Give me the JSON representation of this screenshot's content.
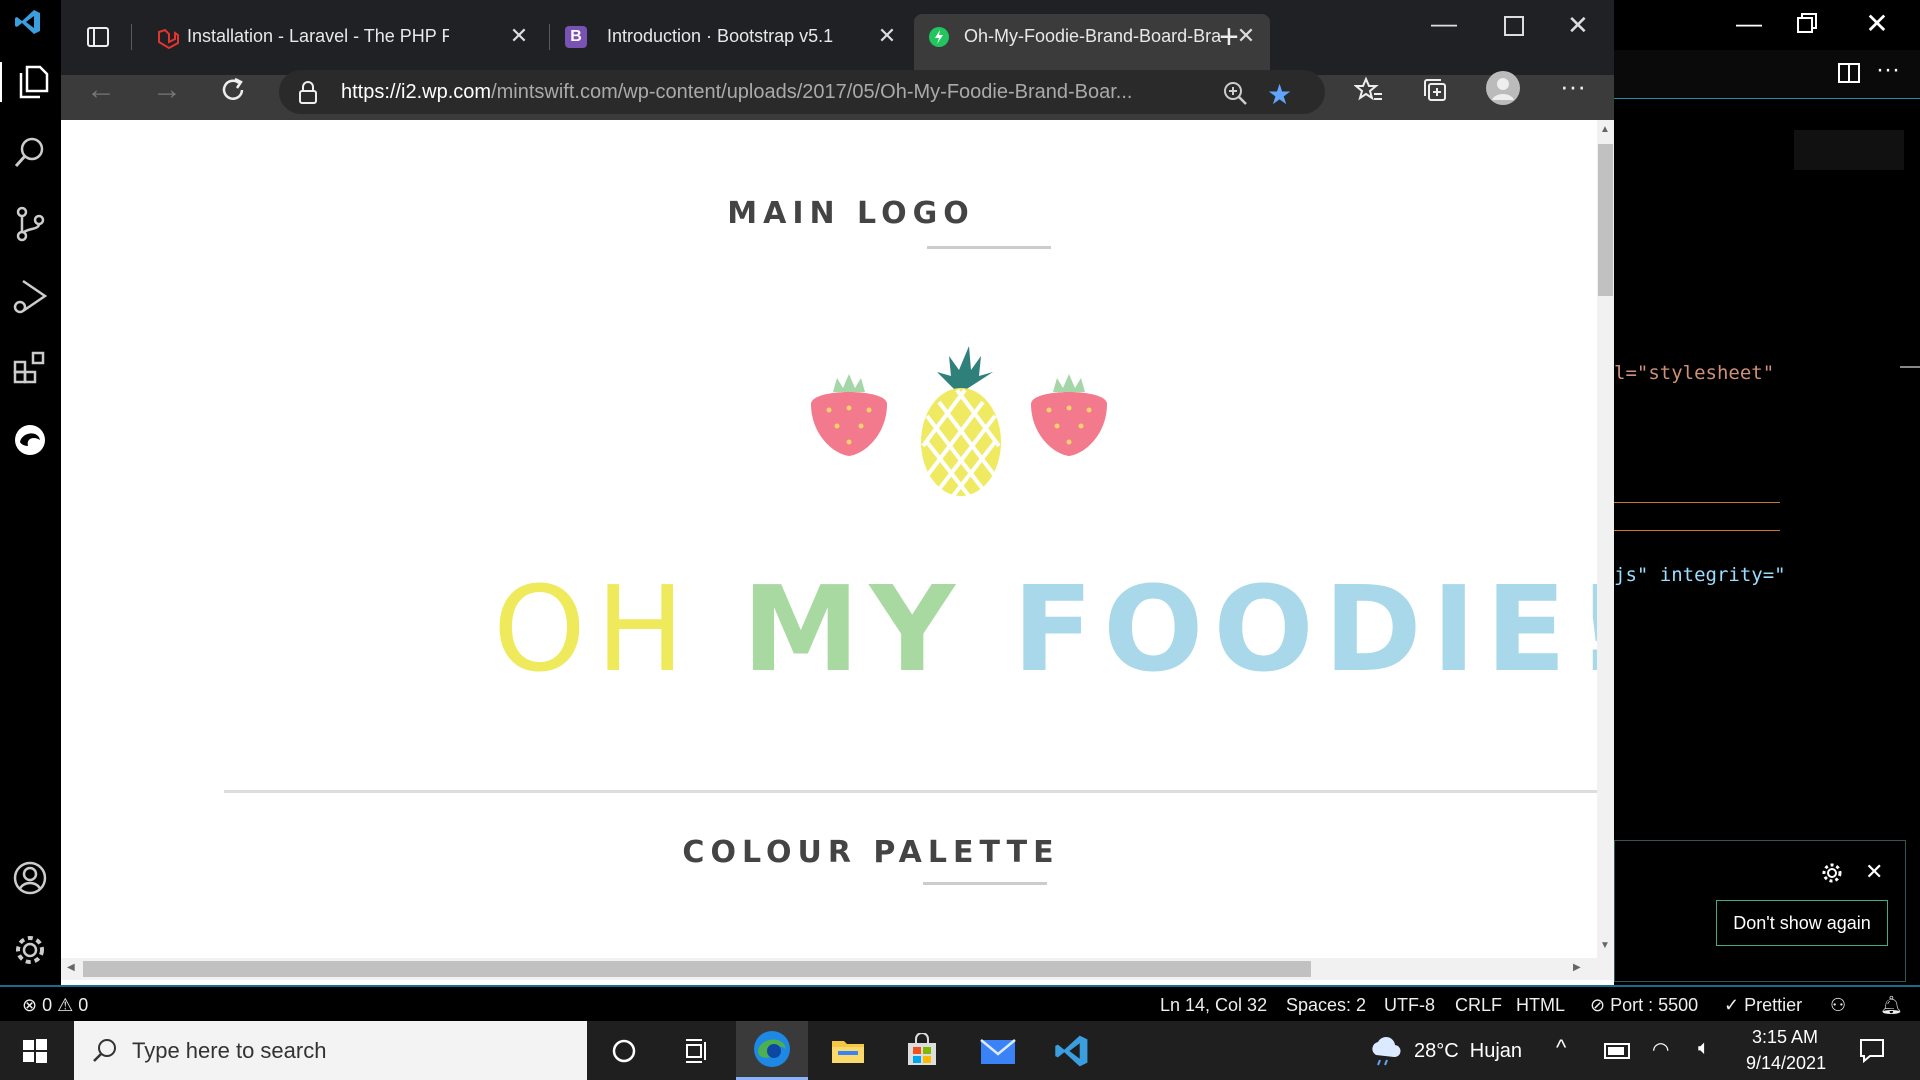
{
  "browser": {
    "tabs": [
      {
        "title": "Installation - Laravel - The PHP F",
        "icon": "laravel-icon",
        "color": "#e3342f"
      },
      {
        "title": "Introduction · Bootstrap v5.1",
        "icon": "bootstrap-icon",
        "color": "#7952b3"
      },
      {
        "title": "Oh-My-Foodie-Brand-Board-Bra",
        "icon": "tab-favicon-icon",
        "color": "#22c55e"
      }
    ],
    "active_tab": 2,
    "url_prefix": "https://",
    "url_host": "i2.wp.com",
    "url_path": "/mintswift.com/wp-content/uploads/2017/05/Oh-My-Foodie-Brand-Boar..."
  },
  "page": {
    "heading_logo": "MAIN LOGO",
    "brand_word1": "OH",
    "brand_word2": "MY",
    "brand_word3": "FOODIE!",
    "heading_palette": "COLOUR PALETTE",
    "colors": {
      "yellow": "#eeea5c",
      "green": "#a7d9a0",
      "blue": "#a8d8e9",
      "strawberry": "#f27a8c",
      "pineapple": "#f0ea62",
      "leaf": "#2f7f7b"
    }
  },
  "editor": {
    "code_line1": "l=\"stylesheet\"",
    "code_line2": "js\" integrity=\""
  },
  "notification": {
    "dont_show": "Don't show again"
  },
  "statusbar": {
    "errors": "0",
    "warnings": "0",
    "position": "Ln 14, Col 32",
    "spaces": "Spaces: 2",
    "encoding": "UTF-8",
    "eol": "CRLF",
    "language": "HTML",
    "port": "Port : 5500",
    "prettier": "Prettier"
  },
  "taskbar": {
    "search_placeholder": "Type here to search",
    "weather": "28°C  Hujan",
    "time": "3:15 AM",
    "date": "9/14/2021"
  }
}
